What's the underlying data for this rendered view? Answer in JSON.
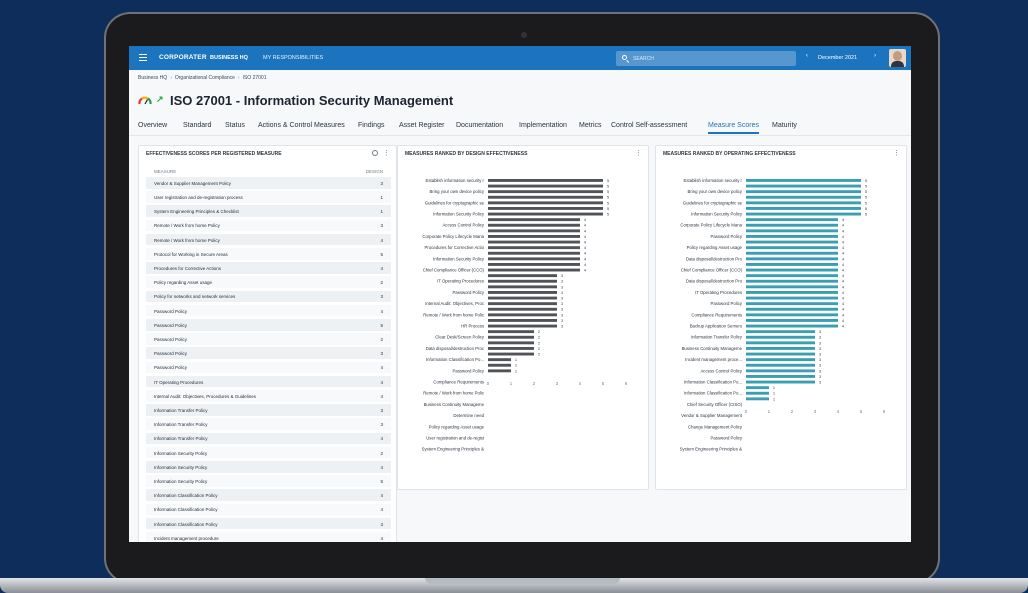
{
  "app": {
    "logo": "CORPORATER",
    "nav": [
      "BUSINESS HQ",
      "MY RESPONSIBILITIES"
    ],
    "search_placeholder": "SEARCH",
    "period": "December 2021",
    "colors": {
      "topbar": "#1d74be",
      "accent": "#1d74be",
      "design_bar": "#505458",
      "operating_bar": "#3a9fb2"
    }
  },
  "breadcrumb": [
    "Business HQ",
    "Organizational Compliance",
    "ISO 27001"
  ],
  "page": {
    "title": "ISO 27001 - Information Security Management",
    "status_icon": "gauge-icon",
    "trend_icon": "trend-up-icon"
  },
  "tabs": [
    {
      "label": "Overview"
    },
    {
      "label": "Standard"
    },
    {
      "label": "Status"
    },
    {
      "label": "Actions & Control Measures"
    },
    {
      "label": "Findings"
    },
    {
      "label": "Asset Register"
    },
    {
      "label": "Documentation"
    },
    {
      "label": "Implementation"
    },
    {
      "label": "Metrics"
    },
    {
      "label": "Control Self-assessment"
    },
    {
      "label": "Measure Scores",
      "active": true
    },
    {
      "label": "Maturity"
    }
  ],
  "table_panel": {
    "title": "EFFECTIVENESS SCORES PER REGISTERED MEASURE",
    "columns": [
      "MEASURE",
      "DESIGN"
    ],
    "rows": [
      [
        "Vendor & Supplier Management Policy",
        "3"
      ],
      [
        "User registration and de-registration process",
        "1"
      ],
      [
        "System Engineering Principles & Checklist",
        "1"
      ],
      [
        "Remote / Work from home Policy",
        "3"
      ],
      [
        "Remote / Work from home Policy",
        "4"
      ],
      [
        "Protocol for Working in Secure Areas",
        "5"
      ],
      [
        "Procedures for Corrective Actions",
        "4"
      ],
      [
        "Policy regarding Asset usage",
        "2"
      ],
      [
        "Policy for networks and network services",
        "3"
      ],
      [
        "Password Policy",
        "4"
      ],
      [
        "Password Policy",
        "5"
      ],
      [
        "Password Policy",
        "2"
      ],
      [
        "Password Policy",
        "3"
      ],
      [
        "Password Policy",
        "4"
      ],
      [
        "IT Operating Procedures",
        "4"
      ],
      [
        "Internal Audit: Objectives, Procedures & Guidelines",
        "4"
      ],
      [
        "Information Transfer Policy",
        "3"
      ],
      [
        "Information Transfer Policy",
        "3"
      ],
      [
        "Information Transfer Policy",
        "4"
      ],
      [
        "Information Security Policy",
        "2"
      ],
      [
        "Information Security Policy",
        "4"
      ],
      [
        "Information Security Policy",
        "5"
      ],
      [
        "Information Classification Policy",
        "4"
      ],
      [
        "Information Classification Policy",
        "4"
      ],
      [
        "Information Classification Policy",
        "3"
      ],
      [
        "Incident management procedure",
        "4"
      ]
    ]
  },
  "chart_data": [
    {
      "type": "bar",
      "orientation": "horizontal",
      "title": "MEASURES RANKED BY DESIGN EFFECTIVENESS",
      "xlim": [
        0,
        6
      ],
      "xticks": [
        0,
        1,
        2,
        3,
        4,
        5,
        6
      ],
      "color": "#505458",
      "categories": [
        "Establish information security r",
        "Bring your own device policy",
        "Guidelines for cryptographic se",
        "Information Security Policy",
        "Access Control Policy",
        "Corporate Policy Lifecycle Mana",
        "Procedures for Corrective Actio",
        "Information Security Policy",
        "Chief Compliance Officer (CCO)",
        "IT Operating Procedures",
        "Password Policy",
        "Internal Audit: Objectives, Proc",
        "Remote / Work from home Polic",
        "HR Process",
        "Clear Desk/Screen Policy",
        "Data disposal/destruction Proc",
        "Information Classification Po...",
        "Password Policy",
        "Compliance Requirements",
        "Remote / Work from home Polic",
        "Business Continuity Manageme",
        "Determine need",
        "Policy regarding Asset usage",
        "User registration and de-regist",
        "System Engineering Principles &"
      ],
      "values": [
        5,
        5,
        5,
        5,
        5,
        5,
        5,
        4,
        4,
        4,
        4,
        4,
        4,
        4,
        4,
        4,
        4,
        3,
        3,
        3,
        3,
        3,
        3,
        3,
        3,
        3,
        3,
        2,
        2,
        2,
        2,
        2,
        1,
        1,
        1
      ],
      "label_rows": [
        0,
        2,
        4,
        6,
        8,
        10,
        12,
        14,
        16,
        18,
        20,
        22,
        24,
        26,
        28,
        30,
        32,
        34,
        36,
        38,
        40,
        42,
        44,
        46,
        48
      ]
    },
    {
      "type": "bar",
      "orientation": "horizontal",
      "title": "MEASURES RANKED BY OPERATING EFFECTIVENESS",
      "xlim": [
        0,
        6
      ],
      "xticks": [
        0,
        1,
        2,
        3,
        4,
        5,
        6
      ],
      "color": "#3a9fb2",
      "categories": [
        "Establish information security r",
        "Bring your own device policy",
        "Guidelines for cryptographic se",
        "Information Security Policy",
        "Corporate Policy Lifecycle Mana",
        "Password Policy",
        "Policy regarding Asset usage",
        "Data disposal/destruction Pro",
        "Chief Compliance Officer (CCO)",
        "Data disposal/destruction Pro",
        "IT Operating Procedures",
        "Password Policy",
        "Compliance Requirements",
        "Backup Application Servers",
        "Information Transfer Policy",
        "Business Continuity Manageme",
        "Incident management proce...",
        "Access Control Policy",
        "Information Classification Po...",
        "Information Classification Po...",
        "Chief Security Officer (CISO)",
        "Vendor & Supplier Management",
        "Change Management Policy",
        "Password Policy",
        "System Engineering Principles &"
      ],
      "values": [
        5,
        5,
        5,
        5,
        5,
        5,
        5,
        4,
        4,
        4,
        4,
        4,
        4,
        4,
        4,
        4,
        4,
        4,
        4,
        4,
        4,
        4,
        4,
        4,
        4,
        4,
        4,
        3,
        3,
        3,
        3,
        3,
        3,
        3,
        3,
        3,
        3,
        1,
        1,
        1
      ],
      "label_rows": [
        0,
        2,
        4,
        6,
        8,
        10,
        12,
        14,
        16,
        18,
        20,
        22,
        24,
        26,
        28,
        30,
        32,
        34,
        36,
        38,
        40,
        42,
        44,
        46,
        48
      ]
    }
  ]
}
